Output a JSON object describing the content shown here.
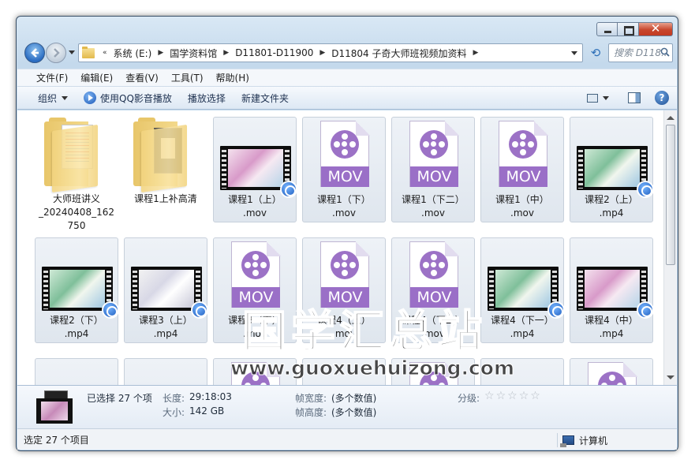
{
  "window": {
    "close_glyph": "✕"
  },
  "address": {
    "overflow": "«",
    "crumbs": [
      "系统 (E:)",
      "国学资料馆",
      "D11801-D11900",
      "D11804 子奇大师班视频加资料"
    ]
  },
  "search": {
    "placeholder": "搜索 D118..."
  },
  "menu": [
    "文件(F)",
    "编辑(E)",
    "查看(V)",
    "工具(T)",
    "帮助(H)"
  ],
  "toolbar": {
    "organize": "组织",
    "qq_play": "使用QQ影音播放",
    "play_selection": "播放选择",
    "new_folder": "新建文件夹",
    "help": "?"
  },
  "files": [
    {
      "name": "大师班讲义_20240408_162750",
      "label_lines": [
        "大师班讲义",
        "_20240408_162",
        "750"
      ],
      "kind": "folder-doc"
    },
    {
      "name": "课程1上补高清",
      "label_lines": [
        "课程1上补高清"
      ],
      "kind": "folder-dark"
    },
    {
      "name": "课程1（上）.mov",
      "label_lines": [
        "课程1（上）",
        ".mov"
      ],
      "kind": "video-pink"
    },
    {
      "name": "课程1（下）.mov",
      "label_lines": [
        "课程1（下）",
        ".mov"
      ],
      "kind": "mov"
    },
    {
      "name": "课程1（下二）.mov",
      "label_lines": [
        "课程1（下二）",
        ".mov"
      ],
      "kind": "mov"
    },
    {
      "name": "课程1（中）.mov",
      "label_lines": [
        "课程1（中）",
        ".mov"
      ],
      "kind": "mov"
    },
    {
      "name": "课程2（上）.mp4",
      "label_lines": [
        "课程2（上）",
        ".mp4"
      ],
      "kind": "video-green"
    },
    {
      "name": "课程2（下）.mp4",
      "label_lines": [
        "课程2（下）",
        ".mp4"
      ],
      "kind": "video-green"
    },
    {
      "name": "课程3（上）.mp4",
      "label_lines": [
        "课程3（上）",
        ".mp4"
      ],
      "kind": "video-light"
    },
    {
      "name": "课程3（下）.mov",
      "label_lines": [
        "课程3（下）",
        ".mov"
      ],
      "kind": "mov"
    },
    {
      "name": "课程4（上）.mov",
      "label_lines": [
        "课程4（上）",
        ".mov"
      ],
      "kind": "mov"
    },
    {
      "name": "课程4（下二）.mov",
      "label_lines": [
        "课程4（下二）",
        ".mov"
      ],
      "kind": "mov"
    },
    {
      "name": "课程4（下一）.mp4",
      "label_lines": [
        "课程4（下一）",
        ".mp4"
      ],
      "kind": "video-green"
    },
    {
      "name": "课程4（中）.mp4",
      "label_lines": [
        "课程4（中）",
        ".mp4"
      ],
      "kind": "video-pink"
    }
  ],
  "watermark": {
    "title": "国学汇总站",
    "url": "www.guoxuehuizong.com"
  },
  "details": {
    "selected": "已选择 27 个项",
    "length_key": "长度:",
    "length_val": "29:18:03",
    "size_key": "大小:",
    "size_val": "142 GB",
    "frame_width_key": "帧宽度:",
    "frame_width_val": "(多个数值)",
    "frame_height_key": "帧高度:",
    "frame_height_val": "(多个数值)",
    "rating_key": "分级:",
    "rating_stars": 0
  },
  "status": {
    "left": "选定 27 个项目",
    "right": "计算机"
  }
}
